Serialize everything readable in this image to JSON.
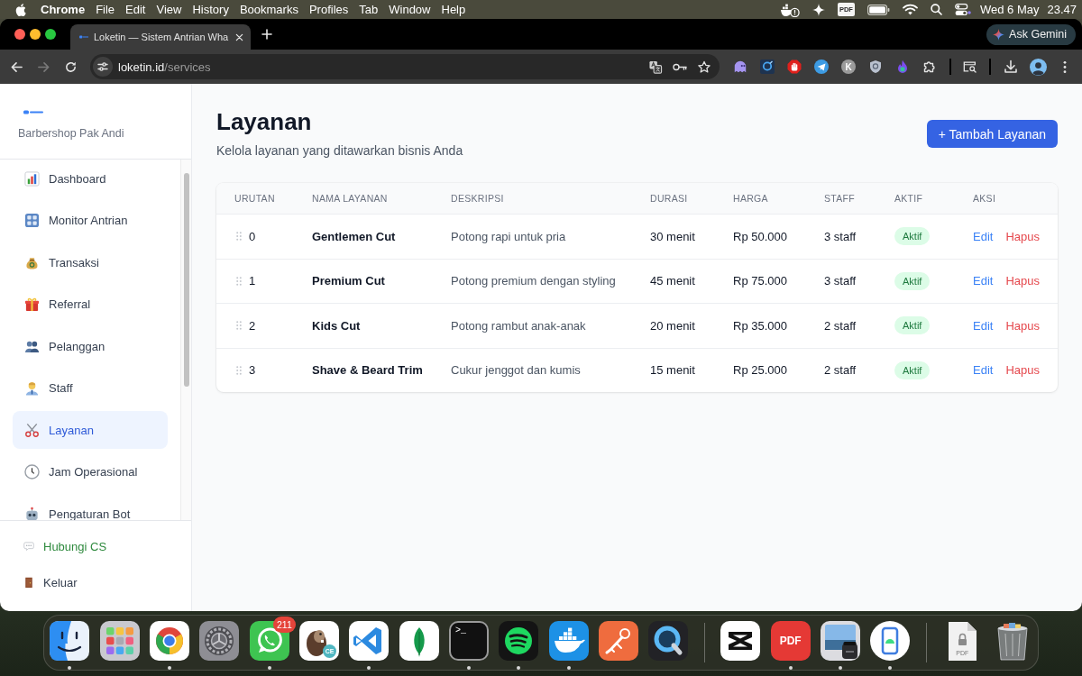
{
  "menu_bar": {
    "app_name": "Chrome",
    "menus": [
      "File",
      "Edit",
      "View",
      "History",
      "Bookmarks",
      "Profiles",
      "Tab",
      "Window",
      "Help"
    ],
    "pdf_label": "PDF",
    "date": "Wed 6 May",
    "time": "23.47"
  },
  "browser": {
    "tabs": [
      {
        "title": "Loketin — Sistem Antrian Wha",
        "selected": true
      }
    ],
    "gemini_button": "Ask Gemini",
    "forward_enabled": false,
    "url_host": "loketin.id",
    "url_path": "/services",
    "extension_letter": "K"
  },
  "sidebar": {
    "business_name": "Barbershop Pak Andi",
    "items": [
      {
        "label": "Dashboard",
        "selected": false
      },
      {
        "label": "Monitor Antrian",
        "selected": false
      },
      {
        "label": "Transaksi",
        "selected": false
      },
      {
        "label": "Referral",
        "selected": false
      },
      {
        "label": "Pelanggan",
        "selected": false
      },
      {
        "label": "Staff",
        "selected": false
      },
      {
        "label": "Layanan",
        "selected": true
      },
      {
        "label": "Jam Operasional",
        "selected": false
      },
      {
        "label": "Pengaturan Bot",
        "selected": false
      }
    ],
    "footer_items": [
      {
        "label": "Hubungi CS",
        "kind": "support"
      },
      {
        "label": "Keluar",
        "kind": "logout"
      }
    ]
  },
  "page": {
    "title": "Layanan",
    "subtitle": "Kelola layanan yang ditawarkan bisnis Anda",
    "add_button": "+ Tambah Layanan"
  },
  "table": {
    "columns": [
      "URUTAN",
      "NAMA LAYANAN",
      "DESKRIPSI",
      "DURASI",
      "HARGA",
      "STAFF",
      "AKTIF",
      "AKSI"
    ],
    "rows": [
      {
        "order": "0",
        "name": "Gentlemen Cut",
        "description": "Potong rapi untuk pria",
        "duration": "30 menit",
        "price": "Rp 50.000",
        "staff": "3 staff",
        "status": "Aktif",
        "active": true,
        "actions": [
          {
            "label": "Edit",
            "kind": "edit"
          },
          {
            "label": "Hapus",
            "kind": "delete"
          }
        ]
      },
      {
        "order": "1",
        "name": "Premium Cut",
        "description": "Potong premium dengan styling",
        "duration": "45 menit",
        "price": "Rp 75.000",
        "staff": "3 staff",
        "status": "Aktif",
        "active": true,
        "actions": [
          {
            "label": "Edit",
            "kind": "edit"
          },
          {
            "label": "Hapus",
            "kind": "delete"
          }
        ]
      },
      {
        "order": "2",
        "name": "Kids Cut",
        "description": "Potong rambut anak-anak",
        "duration": "20 menit",
        "price": "Rp 35.000",
        "staff": "2 staff",
        "status": "Aktif",
        "active": true,
        "actions": [
          {
            "label": "Edit",
            "kind": "edit"
          },
          {
            "label": "Hapus",
            "kind": "delete"
          }
        ]
      },
      {
        "order": "3",
        "name": "Shave & Beard Trim",
        "description": "Cukur jenggot dan kumis",
        "duration": "15 menit",
        "price": "Rp 25.000",
        "staff": "2 staff",
        "status": "Aktif",
        "active": true,
        "actions": [
          {
            "label": "Edit",
            "kind": "edit"
          },
          {
            "label": "Hapus",
            "kind": "delete"
          }
        ]
      }
    ]
  },
  "dock": {
    "apps": [
      {
        "running": true
      },
      {
        "running": false
      },
      {
        "running": true
      },
      {
        "running": false
      },
      {
        "running": true,
        "badge": "211"
      },
      {
        "running": false,
        "label": "CE"
      },
      {
        "running": true
      },
      {
        "running": false
      },
      {
        "running": true,
        "label": ">_"
      },
      {
        "running": true
      },
      {
        "running": true
      },
      {
        "running": false
      },
      {
        "running": false
      }
    ],
    "recent": [
      {
        "running": false
      },
      {
        "running": true,
        "label": "PDF"
      },
      {
        "running": true
      },
      {
        "running": true
      }
    ],
    "others": [
      {
        "running": false,
        "label": "PDF"
      },
      {
        "running": false
      }
    ]
  }
}
